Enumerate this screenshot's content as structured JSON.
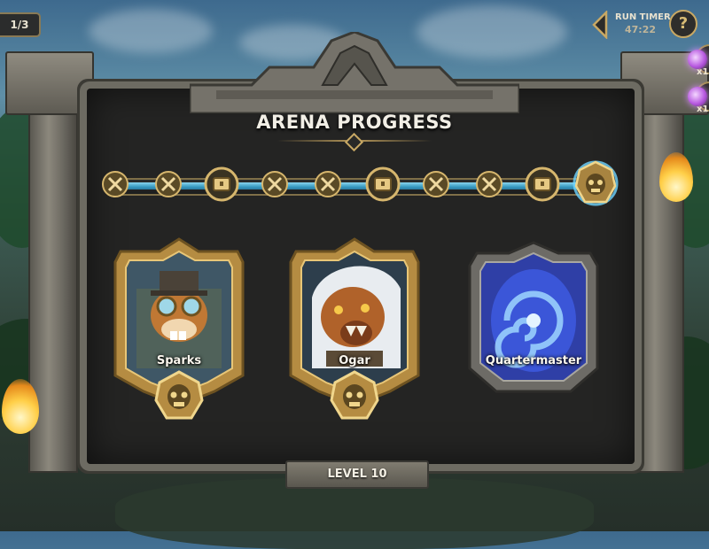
{
  "header": {
    "page_indicator": "1/3",
    "title": "ARENA PROGRESS",
    "run_timer_label": "RUN TIMER",
    "run_timer_value": "47:22",
    "help_label": "?"
  },
  "side_items": [
    {
      "icon": "purple-orb-icon",
      "count": "x1"
    },
    {
      "icon": "purple-orb-icon",
      "count": "x1"
    }
  ],
  "progress": {
    "fill_fraction": 1.0,
    "nodes": [
      "crossed-swords",
      "crossed-swords",
      "chest",
      "crossed-swords",
      "crossed-swords",
      "chest",
      "crossed-swords",
      "crossed-swords",
      "chest",
      "boss-skull"
    ],
    "track_color": "#3a9cc4"
  },
  "cards": [
    {
      "name": "Sparks",
      "type": "hero",
      "frame": "gold"
    },
    {
      "name": "Ogar",
      "type": "hero",
      "frame": "gold"
    },
    {
      "name": "Quartermaster",
      "type": "vendor",
      "frame": "silver"
    }
  ],
  "footer": {
    "level_label": "LEVEL 10"
  },
  "colors": {
    "gold": "#c8a864",
    "accent_blue": "#3a9cc4",
    "portal_blue": "#3b56d8"
  }
}
